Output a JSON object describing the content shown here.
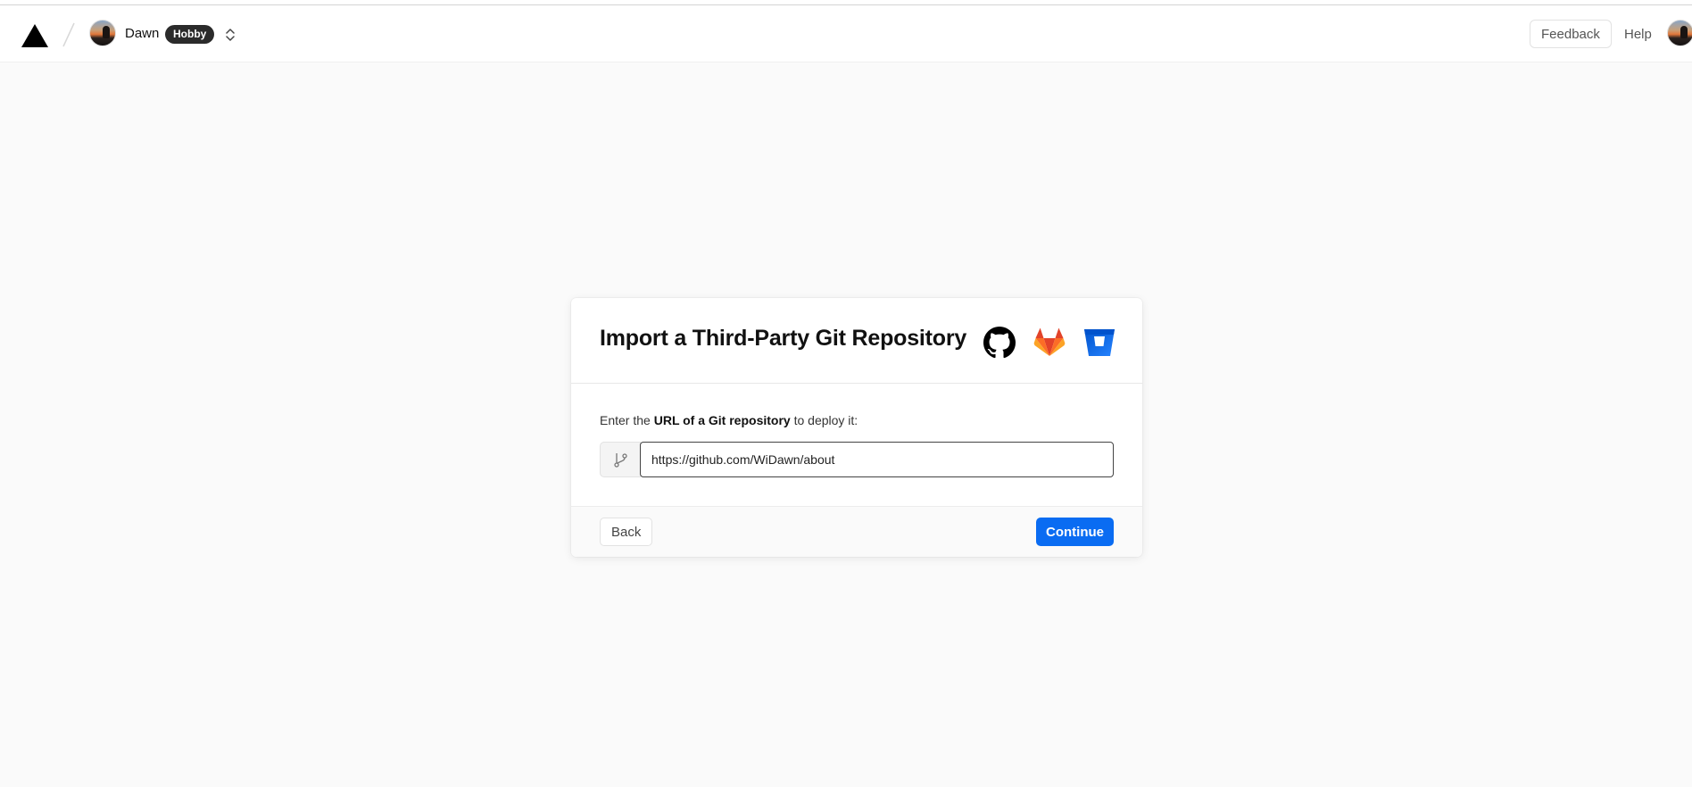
{
  "header": {
    "user_name": "Dawn",
    "plan_badge": "Hobby",
    "feedback_label": "Feedback",
    "help_label": "Help",
    "icons": {
      "logo": "vercel-triangle-icon",
      "slash": "breadcrumb-slash-icon",
      "switcher": "chevron-up-down-icon"
    }
  },
  "dialog": {
    "title": "Import a Third-Party Git Repository",
    "providers": [
      "github-icon",
      "gitlab-icon",
      "bitbucket-icon"
    ],
    "prompt_prefix": "Enter the",
    "prompt_bold": "URL of a Git repository",
    "prompt_suffix": "to deploy it:",
    "url_value": "https://github.com/WiDawn/about",
    "back_label": "Back",
    "continue_label": "Continue"
  },
  "colors": {
    "accent": "#0a6cf2",
    "gitlab": "#e24329",
    "bitbucket": "#2684ff",
    "background": "#fafafa"
  }
}
